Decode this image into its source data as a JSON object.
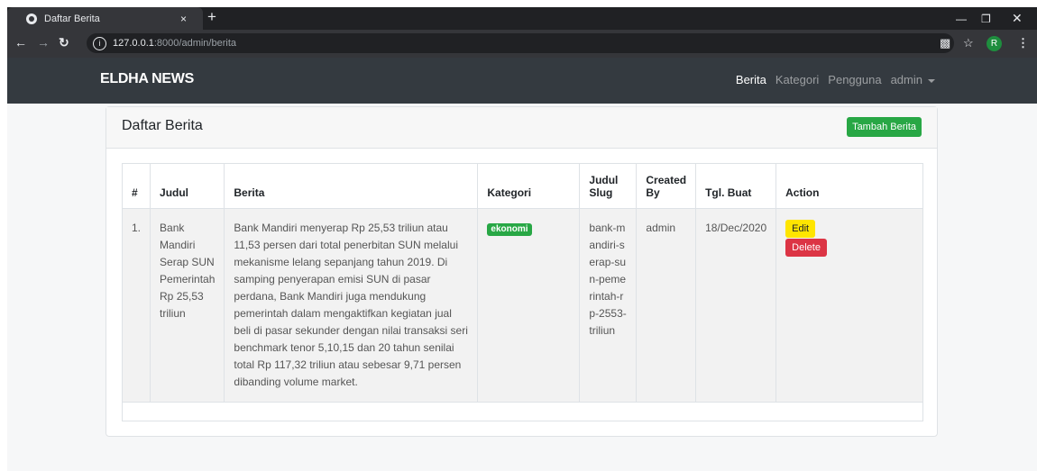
{
  "browser": {
    "tab_title": "Daftar Berita",
    "tab_close": "×",
    "new_tab": "+",
    "url_host": "127.0.0.1",
    "url_rest": ":8000/admin/berita",
    "profile_initial": "R"
  },
  "navbar": {
    "brand": "ELDHA NEWS",
    "links": [
      "Berita",
      "Kategori",
      "Pengguna",
      "admin"
    ]
  },
  "card": {
    "title": "Daftar Berita",
    "add_button": "Tambah Berita"
  },
  "table": {
    "headers": [
      "#",
      "Judul",
      "Berita",
      "Kategori",
      "Judul Slug",
      "Created By",
      "Tgl. Buat",
      "Action"
    ],
    "rows": [
      {
        "no": "1.",
        "judul": "Bank Mandiri Serap SUN Pemerintah Rp 25,53 triliun",
        "berita": "Bank Mandiri menyerap Rp 25,53 triliun atau 11,53 persen dari total penerbitan SUN melalui mekanisme lelang sepanjang tahun 2019. Di samping penyerapan emisi SUN di pasar perdana, Bank Mandiri juga mendukung pemerintah dalam mengaktifkan kegiatan jual beli di pasar sekunder dengan nilai transaksi seri benchmark tenor 5,10,15 dan 20 tahun senilai total Rp 117,32 triliun atau sebesar 9,71 persen dibanding volume market.",
        "kategori": "ekonomi",
        "slug": "bank-mandiri-serap-sun-pemerintah-rp-2553-triliun",
        "created_by": "admin",
        "tgl_buat": "18/Dec/2020",
        "edit": "Edit",
        "delete": "Delete"
      }
    ]
  },
  "colors": {
    "navbar": "#343a40",
    "success": "#28a745",
    "warning": "#ffe500",
    "danger": "#dc3545"
  }
}
